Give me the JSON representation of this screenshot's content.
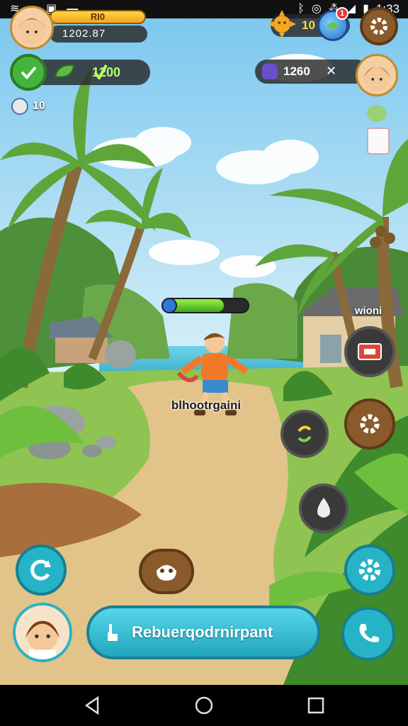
{
  "status_bar": {
    "time": "1:33",
    "left_icons": [
      "wifi-icon",
      "info-icon",
      "gallery-icon",
      "message-icon"
    ],
    "right_icons": [
      "bluetooth-icon",
      "alarm-icon",
      "vibrate-icon",
      "signal-icon",
      "battery-icon"
    ]
  },
  "hud": {
    "xp_label": "RI0",
    "coins": "1202.87",
    "gems": "1200",
    "level": "10",
    "sun_value": "10",
    "globe_badge": "1",
    "energy": "1260"
  },
  "character": {
    "name": "blhootrgaini",
    "health_fraction": 0.72
  },
  "building_label": "wioni",
  "chat": {
    "text": "Rebuerqodrnirpant"
  },
  "player_badge": "+",
  "colors": {
    "sky": "#9fd6f2",
    "grass": "#7cb342",
    "path": "#e2c48a",
    "teal_button": "#27b3c7",
    "brown_button": "#8b5a2b"
  },
  "navigation": [
    "back-icon",
    "home-icon",
    "recents-icon"
  ]
}
